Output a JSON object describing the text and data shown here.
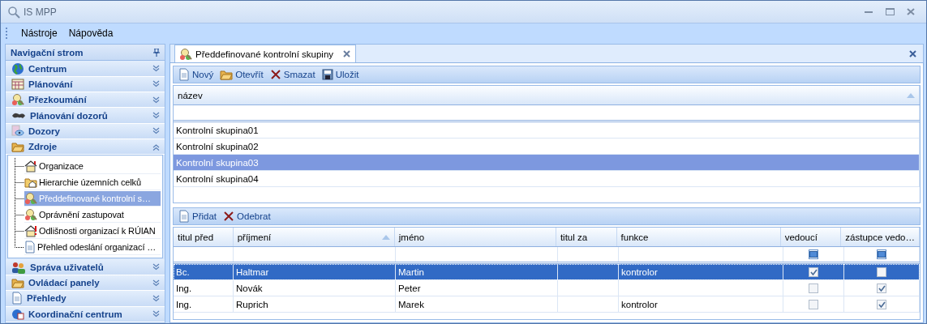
{
  "window": {
    "title": "IS MPP"
  },
  "menu": [
    "Nástroje",
    "Nápověda"
  ],
  "sidebar": {
    "title": "Navigační strom",
    "groups": [
      {
        "label": "Centrum",
        "expanded": false
      },
      {
        "label": "Plánování",
        "expanded": false
      },
      {
        "label": "Přezkoumání",
        "expanded": false
      },
      {
        "label": "Plánování dozorů",
        "expanded": false
      },
      {
        "label": "Dozory",
        "expanded": false
      },
      {
        "label": "Zdroje",
        "expanded": true,
        "children": [
          {
            "label": "Organizace",
            "selected": false
          },
          {
            "label": "Hierarchie územních celků",
            "selected": false
          },
          {
            "label": "Předdefinované kontrolní s…",
            "selected": true
          },
          {
            "label": "Oprávnění zastupovat",
            "selected": false
          },
          {
            "label": "Odlišnosti organizací k RÚIAN",
            "selected": false
          },
          {
            "label": "Přehled odeslání organizací …",
            "selected": false
          }
        ]
      },
      {
        "label": "Správa uživatelů",
        "expanded": false
      },
      {
        "label": "Ovládací panely",
        "expanded": false
      },
      {
        "label": "Přehledy",
        "expanded": false
      },
      {
        "label": "Koordinační centrum",
        "expanded": false
      }
    ]
  },
  "tabs": [
    {
      "label": "Předdefinované kontrolní skupiny",
      "selected": true
    }
  ],
  "toolbar": [
    "Nový",
    "Otevřít",
    "Smazat",
    "Uložit"
  ],
  "groups_table": {
    "columns": [
      {
        "label": "název",
        "sorted": true
      }
    ],
    "rows": [
      {
        "name": "Kontrolní skupina01",
        "selected": false
      },
      {
        "name": "Kontrolní skupina02",
        "selected": false
      },
      {
        "name": "Kontrolní skupina03",
        "selected": true
      },
      {
        "name": "Kontrolní skupina04",
        "selected": false
      }
    ]
  },
  "members_toolbar": [
    "Přidat",
    "Odebrat"
  ],
  "members_table": {
    "columns": [
      {
        "label": "titul před",
        "sorted": false
      },
      {
        "label": "příjmení",
        "sorted": true
      },
      {
        "label": "jméno",
        "sorted": false
      },
      {
        "label": "titul za",
        "sorted": false
      },
      {
        "label": "funkce",
        "sorted": false
      },
      {
        "label": "vedoucí",
        "sorted": false
      },
      {
        "label": "zástupce vedo…",
        "sorted": false
      }
    ],
    "filter_checkboxes": [
      {
        "indeterminate": true
      },
      {
        "indeterminate": true
      }
    ],
    "rows": [
      {
        "titul_pred": "Bc.",
        "prijmeni": "Haltmar",
        "jmeno": "Martin",
        "funkce": "kontrolor",
        "vedouci": true,
        "zastupce": false,
        "selected": true
      },
      {
        "titul_pred": "Ing.",
        "prijmeni": "Novák",
        "jmeno": "Peter",
        "vedouci": false,
        "zastupce": true,
        "selected": false
      },
      {
        "titul_pred": "Ing.",
        "prijmeni": "Ruprich",
        "jmeno": "Marek",
        "funkce": "kontrolor",
        "vedouci": false,
        "zastupce": true,
        "selected": false
      }
    ]
  }
}
